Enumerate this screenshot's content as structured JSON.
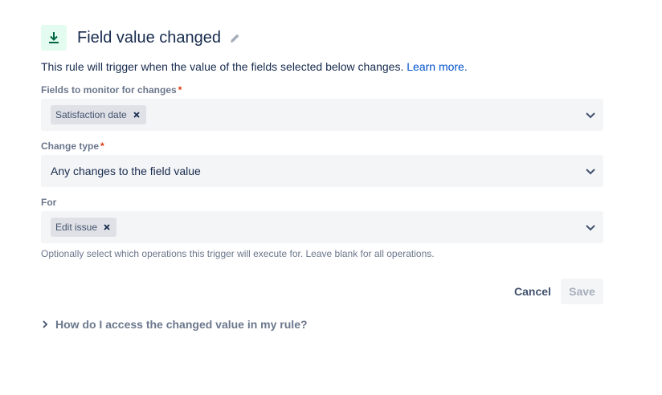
{
  "header": {
    "title": "Field value changed",
    "icon": "download-arrow-icon",
    "accent_color": "#e3fcef",
    "icon_color": "#006644"
  },
  "description": {
    "text": "This rule will trigger when the value of the fields selected below changes.",
    "link": "Learn more."
  },
  "fields_monitor": {
    "label": "Fields to monitor for changes",
    "required_marker": "*",
    "selected": [
      "Satisfaction date"
    ]
  },
  "change_type": {
    "label": "Change type",
    "required_marker": "*",
    "value": "Any changes to the field value"
  },
  "for_field": {
    "label": "For",
    "selected": [
      "Edit issue"
    ],
    "helper": "Optionally select which operations this trigger will execute for. Leave blank for all operations."
  },
  "actions": {
    "cancel": "Cancel",
    "save": "Save"
  },
  "expander": {
    "label": "How do I access the changed value in my rule?"
  }
}
